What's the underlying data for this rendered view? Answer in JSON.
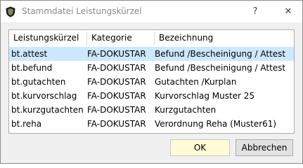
{
  "window": {
    "title": "Stammdatei Leistungskürzel",
    "help_label": "?",
    "close_label": "✕"
  },
  "table": {
    "columns": [
      "Leistungskürzel",
      "Kategorie",
      "Bezeichnung"
    ],
    "rows": [
      [
        "bt.attest",
        "FA-DOKUSTAR",
        "Befund /Bescheinigung / Attest"
      ],
      [
        "bt.befund",
        "FA-DOKUSTAR",
        "Befund /Bescheinigung / Attest"
      ],
      [
        "bt.gutachten",
        "FA-DOKUSTAR",
        "Gutachten /Kurplan"
      ],
      [
        "bt.kurvorschlag",
        "FA-DOKUSTAR",
        "Kurvorschlag Muster 25"
      ],
      [
        "bt.kurzgutachten",
        "FA-DOKUSTAR",
        "Kurzgutachten"
      ],
      [
        "bt.reha",
        "FA-DOKUSTAR",
        "Verordnung Reha (Muster61)"
      ]
    ],
    "selected_row": 0
  },
  "buttons": {
    "ok_label": "OK",
    "cancel_label": "Abbrechen"
  },
  "colors": {
    "selection": "#cce8ff",
    "ok_button": "#fffbd6"
  },
  "icons": {
    "app": "shield-icon",
    "close": "close-icon"
  }
}
